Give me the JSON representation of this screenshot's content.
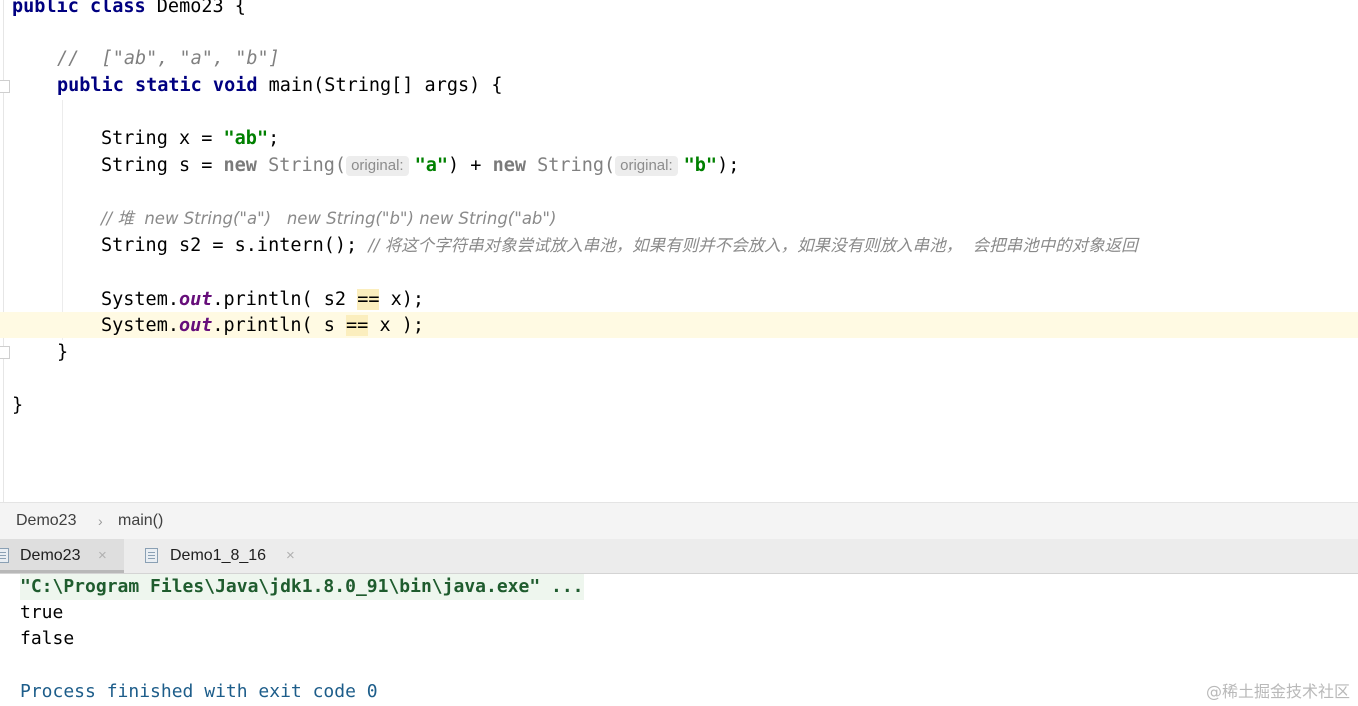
{
  "editor": {
    "line1": {
      "kw": "public class",
      "rest": " Demo23 {"
    },
    "line2_comment": "//  [\"ab\", \"a\", \"b\"]",
    "line3": {
      "kw": "public static void",
      "rest": " main(String[] args) {"
    },
    "line4": {
      "pre": "String x = ",
      "str": "\"ab\"",
      "post": ";"
    },
    "line5": {
      "pre": "String s = ",
      "new1": "new",
      "cls1": " String(",
      "hint1": "original:",
      "str1": "\"a\"",
      "mid": ") + ",
      "new2": "new",
      "cls2": " String(",
      "hint2": "original:",
      "str2": "\"b\"",
      "post": ");"
    },
    "line6_comment": "// 堆  new String(\"a\")   new String(\"b\") new String(\"ab\")",
    "line7": {
      "code": "String s2 = s.intern(); ",
      "comment": "// 将这个字符串对象尝试放入串池，如果有则并不会放入，如果没有则放入串池，  会把串池中的对象返回"
    },
    "line8": {
      "pre": "System.",
      "field": "out",
      "mid": ".println( s2 ",
      "op": "==",
      "post": " x);"
    },
    "line9": {
      "pre": "System.",
      "field": "out",
      "mid": ".println( s ",
      "op": "==",
      "post": " x );"
    },
    "line10": "}",
    "line11": "}"
  },
  "breadcrumb": {
    "item1": "Demo23",
    "separator": "›",
    "item2": "main()"
  },
  "tabs": [
    {
      "label": "Demo23",
      "close": "×",
      "active": true
    },
    {
      "label": "Demo1_8_16",
      "close": "×",
      "active": false
    }
  ],
  "console": {
    "cmd": "\"C:\\Program Files\\Java\\jdk1.8.0_91\\bin\\java.exe\" ...",
    "out1": "true",
    "out2": "false",
    "finished": "Process finished with exit code 0"
  },
  "watermark": "@稀土掘金技术社区"
}
